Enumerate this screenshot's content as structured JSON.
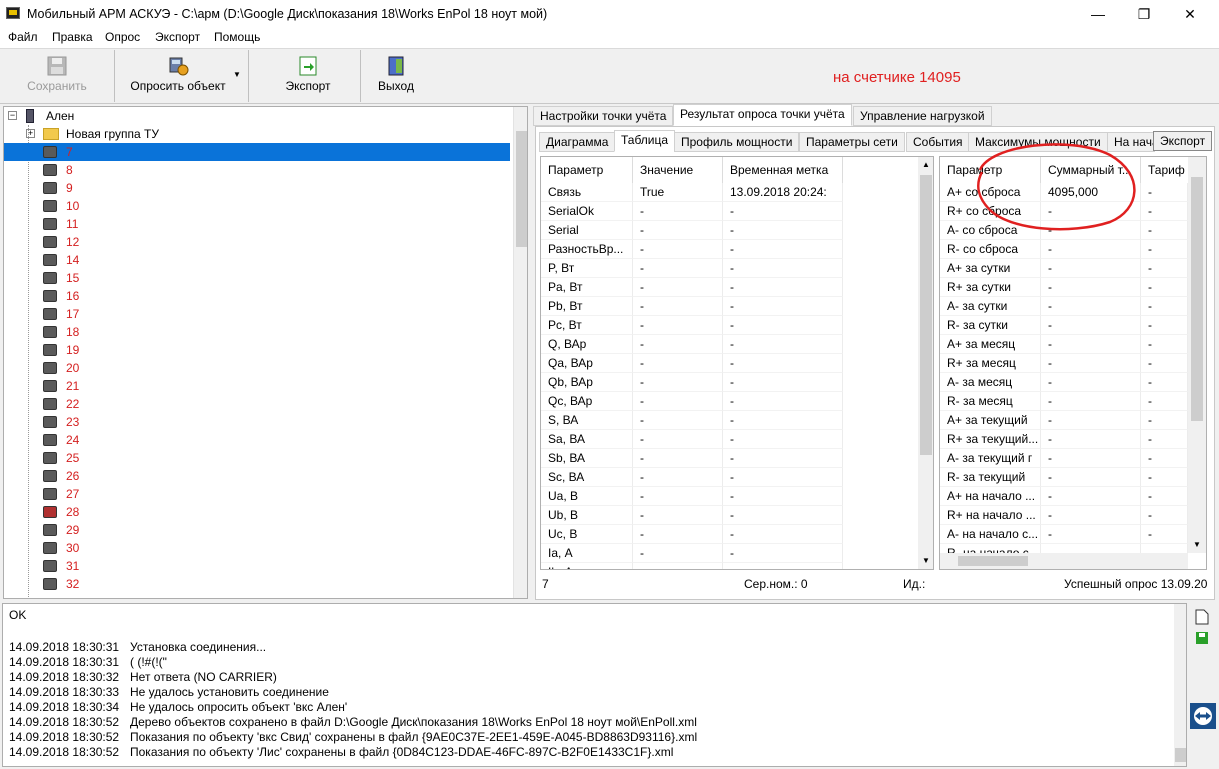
{
  "window": {
    "title": "Мобильный АРМ АСКУЭ - C:\\арм (D:\\Google Диск\\показания 18\\Works EnPol 18 ноут мой)",
    "minimize": "—",
    "maximize": "❐",
    "close": "✕"
  },
  "menu": [
    "Файл",
    "Правка",
    "Опрос",
    "Экспорт",
    "Помощь"
  ],
  "toolbar": {
    "save": "Сохранить",
    "poll": "Опросить объект",
    "export": "Экспорт",
    "exit": "Выход",
    "annotation": "на счетчике 14095"
  },
  "tree": {
    "root": "Ален",
    "group": "Новая группа ТУ",
    "nodes": [
      "7",
      "8",
      "9",
      "10",
      "11",
      "12",
      "14",
      "15",
      "16",
      "17",
      "18",
      "19",
      "20",
      "21",
      "22",
      "23",
      "24",
      "25",
      "26",
      "27",
      "28",
      "29",
      "30",
      "31",
      "32"
    ],
    "selected": "7"
  },
  "tabs_top": [
    "Настройки точки учёта",
    "Результат опроса точки учёта",
    "Управление нагрузкой"
  ],
  "tabs_sub": [
    "Диаграмма",
    "Таблица",
    "Профиль мощности",
    "Параметры сети",
    "События",
    "Максимумы мощности",
    "На нача"
  ],
  "export_button": "Экспорт",
  "left_grid": {
    "headers": [
      "Параметр",
      "Значение",
      "Временная метка"
    ],
    "rows": [
      [
        "Связь",
        "True",
        "13.09.2018 20:24:"
      ],
      [
        "SerialOk",
        "-",
        "-"
      ],
      [
        "Serial",
        "-",
        "-"
      ],
      [
        "РазностьВр...",
        "-",
        "-"
      ],
      [
        "P, Вт",
        "-",
        "-"
      ],
      [
        "Pa, Вт",
        "-",
        "-"
      ],
      [
        "Pb, Вт",
        "-",
        "-"
      ],
      [
        "Pc, Вт",
        "-",
        "-"
      ],
      [
        "Q, ВАр",
        "-",
        "-"
      ],
      [
        "Qa, ВАр",
        "-",
        "-"
      ],
      [
        "Qb, ВАр",
        "-",
        "-"
      ],
      [
        "Qc, ВАр",
        "-",
        "-"
      ],
      [
        "S, ВА",
        "-",
        "-"
      ],
      [
        "Sa, ВА",
        "-",
        "-"
      ],
      [
        "Sb, ВА",
        "-",
        "-"
      ],
      [
        "Sc, ВА",
        "-",
        "-"
      ],
      [
        "Ua, В",
        "-",
        "-"
      ],
      [
        "Ub, В",
        "-",
        "-"
      ],
      [
        "Uc, В",
        "-",
        "-"
      ],
      [
        "Ia, А",
        "-",
        "-"
      ],
      [
        "Ib, А",
        "-",
        "-"
      ]
    ]
  },
  "right_grid": {
    "headers": [
      "Параметр",
      "Суммарный т...",
      "Тариф"
    ],
    "rows": [
      [
        "A+ со сброса",
        "4095,000",
        "-"
      ],
      [
        "R+ со сброса",
        "-",
        "-"
      ],
      [
        "A- со сброса",
        "-",
        "-"
      ],
      [
        "R- со сброса",
        "-",
        "-"
      ],
      [
        "A+ за сутки",
        "-",
        "-"
      ],
      [
        "R+ за сутки",
        "-",
        "-"
      ],
      [
        "A- за сутки",
        "-",
        "-"
      ],
      [
        "R- за сутки",
        "-",
        "-"
      ],
      [
        "A+ за месяц",
        "-",
        "-"
      ],
      [
        "R+ за месяц",
        "-",
        "-"
      ],
      [
        "A- за месяц",
        "-",
        "-"
      ],
      [
        "R- за месяц",
        "-",
        "-"
      ],
      [
        "A+ за текущий",
        "-",
        "-"
      ],
      [
        "R+ за текущий...",
        "-",
        "-"
      ],
      [
        "A- за текущий г",
        "-",
        "-"
      ],
      [
        "R- за текущий",
        "-",
        "-"
      ],
      [
        "A+ на начало ...",
        "-",
        "-"
      ],
      [
        "R+ на начало ...",
        "-",
        "-"
      ],
      [
        "A- на начало с...",
        "-",
        "-"
      ],
      [
        "R- на начало с...",
        "-",
        "-"
      ]
    ]
  },
  "statusbar": {
    "node": "7",
    "serial": "Сер.ном.: 0",
    "id": "Ид.:",
    "result": "Успешный опрос 13.09.20"
  },
  "log": {
    "header": "OK",
    "lines": [
      [
        "14.09.2018 18:30:31",
        "Установка соединения..."
      ],
      [
        "14.09.2018 18:30:31",
        "( (!#(!(\""
      ],
      [
        "14.09.2018 18:30:32",
        "Нет ответа (NO CARRIER)"
      ],
      [
        "14.09.2018 18:30:33",
        "Не удалось установить соединение"
      ],
      [
        "14.09.2018 18:30:34",
        "Не удалось опросить объект 'вкс Ален'"
      ],
      [
        "14.09.2018 18:30:52",
        "Дерево объектов сохранено в файл D:\\Google Диск\\показания 18\\Works EnPol 18 ноут мой\\EnPoll.xml"
      ],
      [
        "14.09.2018 18:30:52",
        "Показания по объекту 'вкс  Свид' сохранены в файл {9AE0C37E-2EE1-459E-A045-BD8863D93116}.xml"
      ],
      [
        "14.09.2018 18:30:52",
        "Показания по объекту 'Лис' сохранены в файл {0D84C123-DDAE-46FC-897C-B2F0E1433C1F}.xml"
      ]
    ]
  }
}
